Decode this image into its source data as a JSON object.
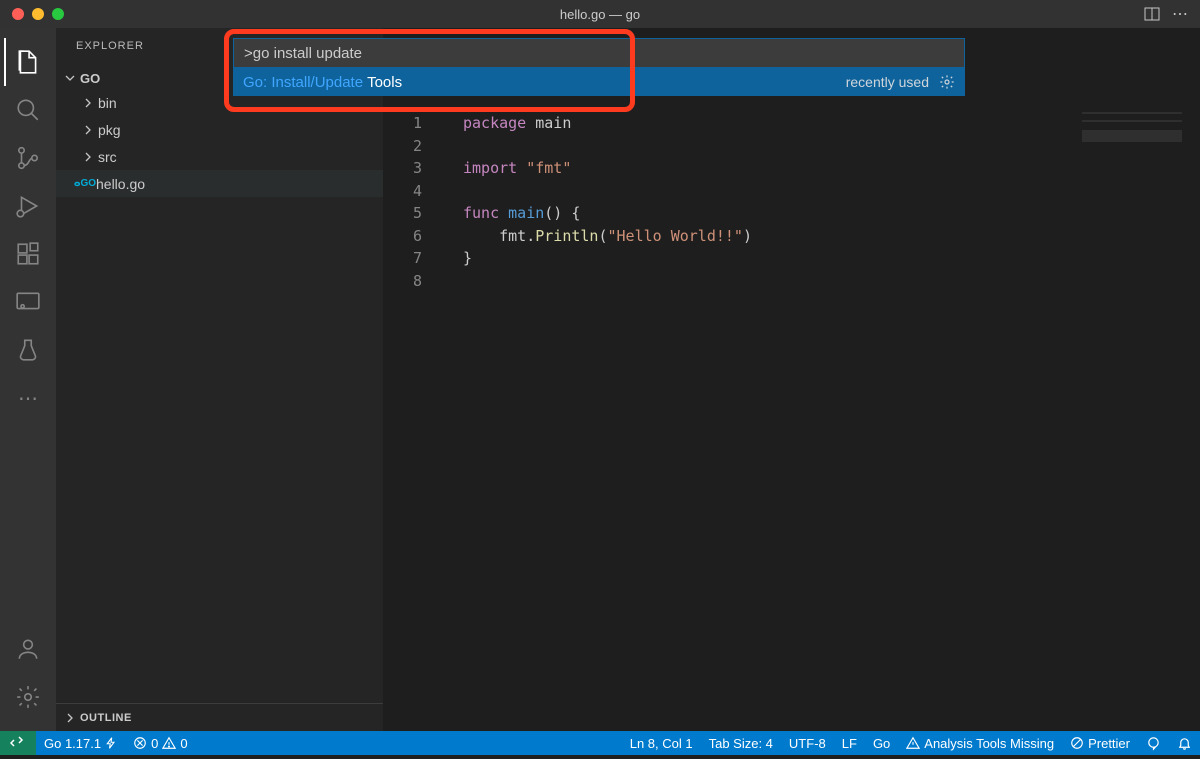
{
  "title": "hello.go — go",
  "explorer": {
    "header": "EXPLORER",
    "rootName": "GO",
    "folders": [
      "bin",
      "pkg",
      "src"
    ],
    "activeFile": "hello.go",
    "outline": "OUTLINE"
  },
  "palette": {
    "inputValue": ">go install update",
    "resultMain": "Go: Install/Update",
    "resultSuffix": "Tools",
    "hint": "recently used"
  },
  "code": {
    "lineNumbers": [
      "1",
      "2",
      "3",
      "4",
      "5",
      "6",
      "7",
      "8"
    ],
    "l1_kw": "package",
    "l1_id": " main",
    "l3_kw": "import",
    "l3_str": " \"fmt\"",
    "l5_kw": "func",
    "l5_fn": " main",
    "l5_rest": "() {",
    "l6_indent": "    fmt.",
    "l6_fn": "Println",
    "l6_open": "(",
    "l6_str": "\"Hello World!!\"",
    "l6_close": ")",
    "l7": "}"
  },
  "status": {
    "goVersion": "Go 1.17.1",
    "errors": "0",
    "warnings": "0",
    "position": "Ln 8, Col 1",
    "tabSize": "Tab Size: 4",
    "encoding": "UTF-8",
    "eol": "LF",
    "lang": "Go",
    "warning": "Analysis Tools Missing",
    "prettier": "Prettier"
  }
}
